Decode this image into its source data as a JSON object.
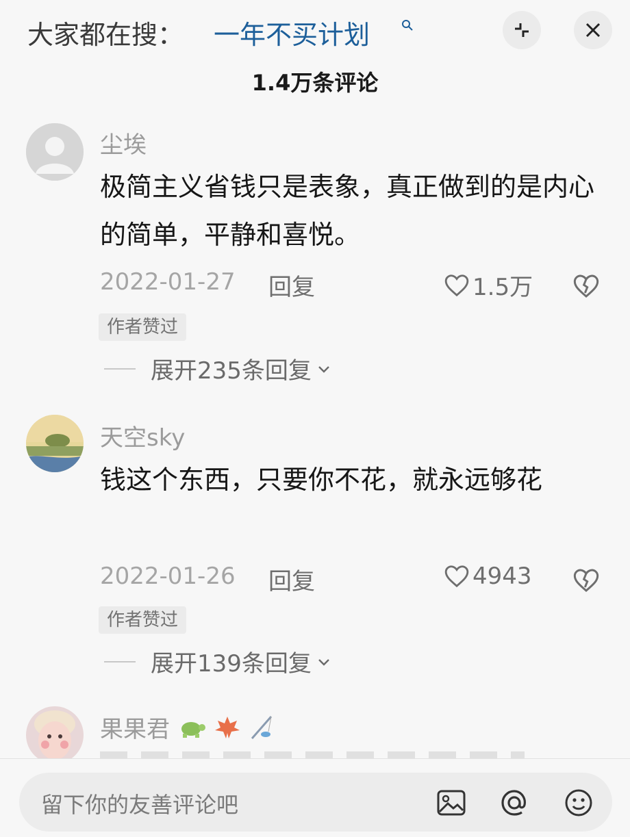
{
  "header": {
    "search_prefix": "大家都在搜：",
    "search_term": "一年不买计划",
    "comment_count": "1.4万条评论"
  },
  "comments": [
    {
      "username": "尘埃",
      "text": "极简主义省钱只是表象，真正做到的是内心的简单，平静和喜悦。",
      "date": "2022-01-27",
      "reply_label": "回复",
      "likes": "1.5万",
      "badge": "作者赞过",
      "expand_label": "展开235条回复"
    },
    {
      "username": "天空sky",
      "text": "钱这个东西，只要你不花，就永远够花",
      "date": "2022-01-26",
      "reply_label": "回复",
      "likes": "4943",
      "badge": "作者赞过",
      "expand_label": "展开139条回复"
    },
    {
      "username": "果果君",
      "emojis": [
        "turtle",
        "maple-leaf",
        "fishing-pole"
      ]
    }
  ],
  "composer": {
    "placeholder": "留下你的友善评论吧",
    "icons": [
      "image-icon",
      "at-icon",
      "emoji-icon"
    ]
  },
  "colors": {
    "accent_blue": "#1d5f9a",
    "muted_text": "#9b9b9b",
    "background": "#f7f7f7"
  }
}
